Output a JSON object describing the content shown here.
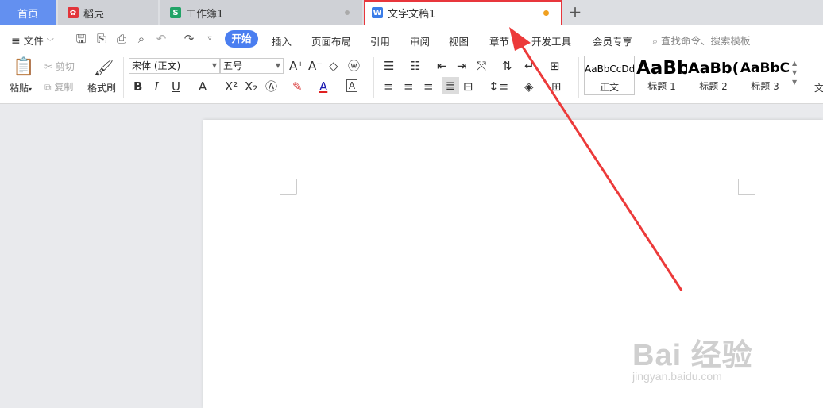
{
  "tabs": {
    "home": "首页",
    "daoke": "稻壳",
    "workbook": "工作簿1",
    "document": "文字文稿1",
    "add": "+"
  },
  "menu": {
    "file": "文件",
    "items": [
      "开始",
      "插入",
      "页面布局",
      "引用",
      "审阅",
      "视图",
      "章节",
      "开发工具",
      "会员专享"
    ],
    "search_placeholder": "查找命令、搜索模板"
  },
  "ribbon": {
    "paste": "粘贴",
    "cut": "剪切",
    "copy": "复制",
    "format_painter": "格式刷",
    "font_name": "宋体 (正文)",
    "font_size": "五号",
    "styles": [
      {
        "sample": "AaBbCcDd",
        "label": "正文"
      },
      {
        "sample": "AaBb",
        "label": "标题 1"
      },
      {
        "sample": "AaBb(",
        "label": "标题 2"
      },
      {
        "sample": "AaBbC",
        "label": "标题 3"
      }
    ],
    "more_text": "文"
  },
  "watermark": {
    "main": "Bai 经验",
    "sub": "jingyan.baidu.com"
  },
  "colors": {
    "accent": "#4a7ef0",
    "highlight": "#e8363c",
    "modified_dot": "#f0a020"
  }
}
